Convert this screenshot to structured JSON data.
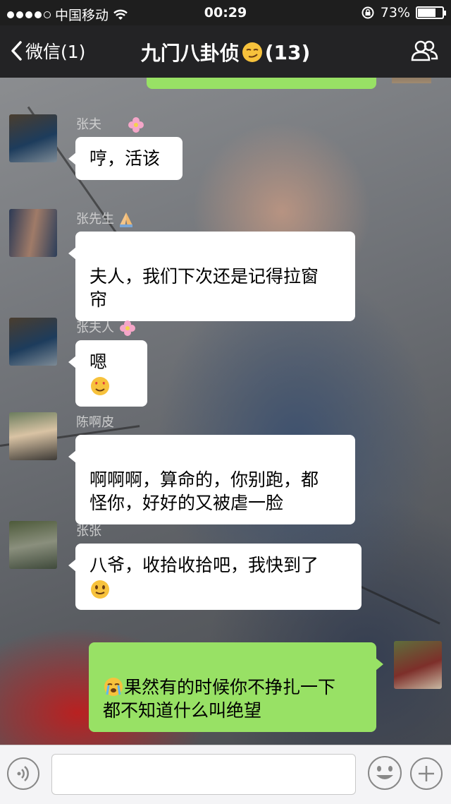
{
  "status_bar": {
    "carrier": "中国移动",
    "time": "00:29",
    "battery": "73%",
    "battery_level": 0.73
  },
  "nav": {
    "back_label": "微信(1)",
    "title": "九门八卦侦",
    "member_count": "(13)"
  },
  "messages": [
    {
      "sender": "张夫",
      "text": "哼，活该"
    },
    {
      "sender": "张先生",
      "text": "夫人，我们下次还是记得拉窗\n帘"
    },
    {
      "sender": "张夫人",
      "text": "嗯"
    },
    {
      "sender": "陈啊皮",
      "text": "啊啊啊，算命的，你别跑，都\n怪你，好好的又被虐一脸"
    },
    {
      "sender": "张张",
      "text": "八爷，收拾收拾吧，我快到了"
    },
    {
      "sender": "",
      "text": "果然有的时候你不挣扎一下\n都不知道什么叫绝望"
    }
  ],
  "colors": {
    "nav_bg": "#232325",
    "bubble_mine": "#98e165",
    "bubble_other": "#ffffff"
  },
  "icons": {
    "back": "chevron-left-icon",
    "members": "people-icon",
    "voice": "voice-icon",
    "emoji": "smile-icon",
    "more": "plus-icon"
  }
}
